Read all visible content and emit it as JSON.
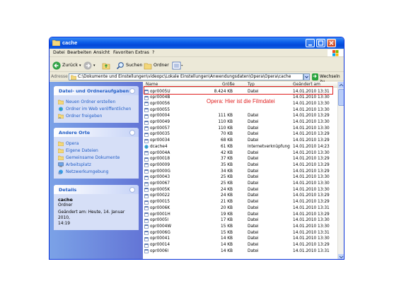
{
  "window": {
    "title": "cache"
  },
  "menu": [
    "Datei",
    "Bearbeiten",
    "Ansicht",
    "Favoriten",
    "Extras",
    "?"
  ],
  "toolbar": {
    "back_label": "Zurück",
    "search_label": "Suchen",
    "folders_label": "Ordner"
  },
  "address": {
    "label": "Adresse",
    "path": "C:\\Dokumente und Einstellungen\\videopc\\Lokale Einstellungen\\Anwendungsdaten\\Opera\\Opera\\cache",
    "go_label": "Wechseln zu"
  },
  "sidebar": {
    "tasks": {
      "title": "Datei- und Ordneraufgaben",
      "items": [
        "Neuen Ordner erstellen",
        "Ordner im Web veröffentlichen",
        "Ordner freigeben"
      ]
    },
    "places": {
      "title": "Andere Orte",
      "items": [
        "Opera",
        "Eigene Dateien",
        "Gemeinsame Dokumente",
        "Arbeitsplatz",
        "Netzwerkumgebung"
      ]
    },
    "details": {
      "title": "Details",
      "name": "cache",
      "kind": "Ordner",
      "changed": "Geändert am: Heute, 14. Januar 2010,",
      "time": "14:19"
    }
  },
  "columns": {
    "name": "Name",
    "size": "Größe",
    "type": "Typ",
    "date": "Geändert am"
  },
  "files": [
    {
      "name": "opr0005U",
      "size": "8.424 KB",
      "type": "Datei",
      "date": "14.01.2010 13:31"
    },
    {
      "name": "opr0004B",
      "size": "",
      "type": "",
      "date": "14.01.2010 13:30"
    },
    {
      "name": "opr00056",
      "size": "",
      "type": "",
      "date": "14.01.2010 13:30"
    },
    {
      "name": "opr00055",
      "size": "",
      "type": "",
      "date": "14.01.2010 13:30"
    },
    {
      "name": "opr00004",
      "size": "111 KB",
      "type": "Datei",
      "date": "14.01.2010 13:29"
    },
    {
      "name": "opr00049",
      "size": "110 KB",
      "type": "Datei",
      "date": "14.01.2010 13:30"
    },
    {
      "name": "opr00057",
      "size": "110 KB",
      "type": "Datei",
      "date": "14.01.2010 13:30"
    },
    {
      "name": "opr00035",
      "size": "70 KB",
      "type": "Datei",
      "date": "14.01.2010 13:29"
    },
    {
      "name": "opr00034",
      "size": "68 KB",
      "type": "Datei",
      "date": "14.01.2010 13:29"
    },
    {
      "name": "dcache4",
      "size": "61 KB",
      "type": "Internetverknüpfung",
      "date": "14.01.2010 14:23"
    },
    {
      "name": "opr0004A",
      "size": "42 KB",
      "type": "Datei",
      "date": "14.01.2010 13:30"
    },
    {
      "name": "opr00018",
      "size": "37 KB",
      "type": "Datei",
      "date": "14.01.2010 13:29"
    },
    {
      "name": "opr00009",
      "size": "35 KB",
      "type": "Datei",
      "date": "14.01.2010 13:29"
    },
    {
      "name": "opr0000G",
      "size": "34 KB",
      "type": "Datei",
      "date": "14.01.2010 13:29"
    },
    {
      "name": "opr00043",
      "size": "25 KB",
      "type": "Datei",
      "date": "14.01.2010 13:30"
    },
    {
      "name": "opr00067",
      "size": "25 KB",
      "type": "Datei",
      "date": "14.01.2010 13:30"
    },
    {
      "name": "opr0005K",
      "size": "24 KB",
      "type": "Datei",
      "date": "14.01.2010 13:30"
    },
    {
      "name": "opr00022",
      "size": "24 KB",
      "type": "Datei",
      "date": "14.01.2010 13:29"
    },
    {
      "name": "opr00015",
      "size": "21 KB",
      "type": "Datei",
      "date": "14.01.2010 13:29"
    },
    {
      "name": "opr0006K",
      "size": "20 KB",
      "type": "Datei",
      "date": "14.01.2010 13:31"
    },
    {
      "name": "opr0001H",
      "size": "19 KB",
      "type": "Datei",
      "date": "14.01.2010 13:29"
    },
    {
      "name": "opr0005I",
      "size": "17 KB",
      "type": "Datei",
      "date": "14.01.2010 13:30"
    },
    {
      "name": "opr0004W",
      "size": "15 KB",
      "type": "Datei",
      "date": "14.01.2010 13:30"
    },
    {
      "name": "opr0006G",
      "size": "15 KB",
      "type": "Datei",
      "date": "14.01.2010 13:31"
    },
    {
      "name": "opr00041",
      "size": "14 KB",
      "type": "Datei",
      "date": "14.01.2010 13:30"
    },
    {
      "name": "opr00014",
      "size": "14 KB",
      "type": "Datei",
      "date": "14.01.2010 13:29"
    },
    {
      "name": "opr0006I",
      "size": "14 KB",
      "type": "Datei",
      "date": "14.01.2010 13:31"
    }
  ],
  "annotation": "Opera: Hier ist die Filmdatei",
  "colors": {
    "titlebar": "#0a5ce8",
    "sidebar": "#6c8ee0",
    "link": "#215dc6",
    "annotation": "#e02020"
  }
}
